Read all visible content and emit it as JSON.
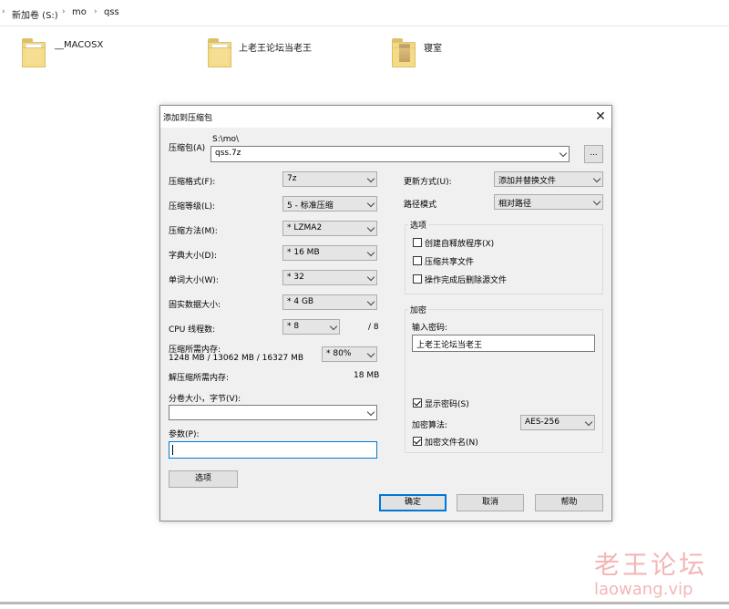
{
  "explorer": {
    "breadcrumb": [
      "新加卷 (S:)",
      "mo",
      "qss"
    ],
    "folders": [
      "__MACOSX",
      "上老王论坛当老王",
      "寝室"
    ]
  },
  "dialog": {
    "title": "添加到压缩包",
    "archive": {
      "label": "压缩包(A)",
      "path": "S:\\mo\\",
      "name": "qss.7z",
      "browse_label": "..."
    },
    "left": {
      "format_label": "压缩格式(F):",
      "format_value": "7z",
      "level_label": "压缩等级(L):",
      "level_value": "5 - 标准压缩",
      "method_label": "压缩方法(M):",
      "method_value": "* LZMA2",
      "dict_label": "字典大小(D):",
      "dict_value": "* 16 MB",
      "word_label": "单词大小(W):",
      "word_value": "* 32",
      "solid_label": "固实数据大小:",
      "solid_value": "* 4 GB",
      "threads_label": "CPU 线程数:",
      "threads_value": "* 8",
      "threads_total": "/ 8",
      "mem_label": "压缩所需内存:",
      "mem_detail": "1248 MB / 13062 MB / 16327 MB",
      "mem_pct": "* 80%",
      "decomp_label": "解压缩所需内存:",
      "decomp_value": "18 MB",
      "split_label": "分卷大小，字节(V):",
      "split_value": "",
      "params_label": "参数(P):",
      "params_value": "",
      "options_button": "选项"
    },
    "right": {
      "update_label": "更新方式(U):",
      "update_value": "添加并替换文件",
      "path_label": "路径模式",
      "path_value": "相对路径",
      "options_title": "选项",
      "opt_sfx": "创建自释放程序(X)",
      "opt_shared": "压缩共享文件",
      "opt_delete": "操作完成后删除源文件",
      "enc_title": "加密",
      "pwd_label": "输入密码:",
      "pwd_value": "上老王论坛当老王",
      "show_pwd": "显示密码(S)",
      "enc_method_label": "加密算法:",
      "enc_method_value": "AES-256",
      "enc_names": "加密文件名(N)"
    },
    "buttons": {
      "ok": "确定",
      "cancel": "取消",
      "help": "帮助"
    }
  },
  "watermark": {
    "cn": "老王论坛",
    "en": "laowang.vip"
  }
}
